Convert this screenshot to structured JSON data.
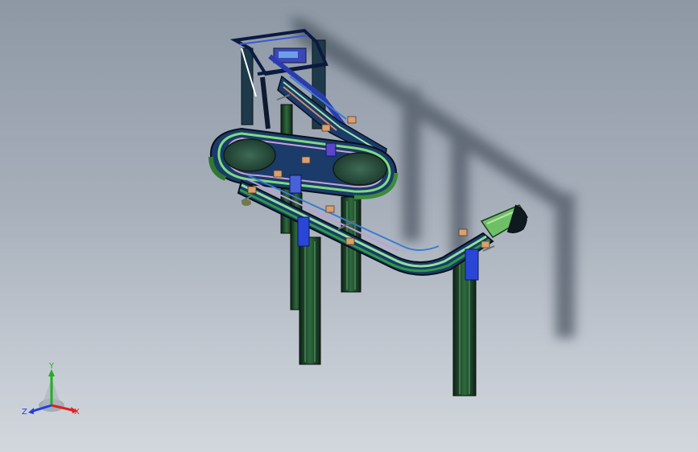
{
  "viewport": {
    "background_top": "#8e98a5",
    "background_bottom": "#d2d7dd",
    "model": "conveyor-assembly"
  },
  "triad": {
    "x_label": "X",
    "y_label": "Y",
    "z_label": "Z",
    "x_color": "#e02020",
    "y_color": "#20b020",
    "z_color": "#2040e0"
  }
}
